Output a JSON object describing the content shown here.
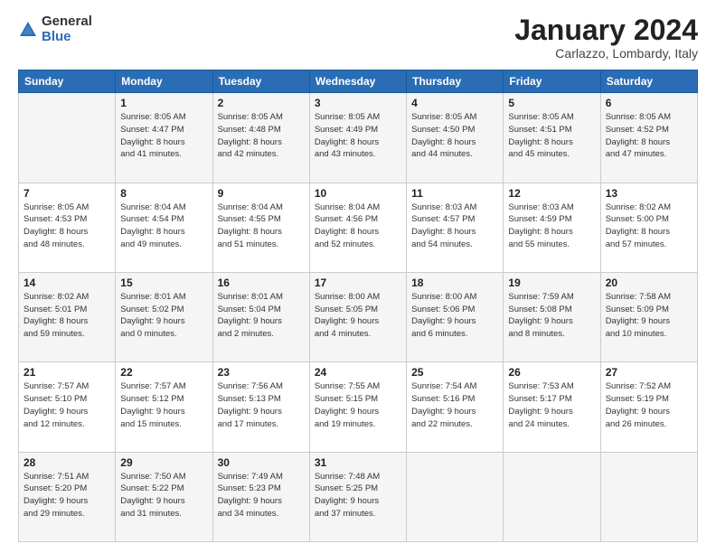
{
  "logo": {
    "general": "General",
    "blue": "Blue"
  },
  "header": {
    "month": "January 2024",
    "location": "Carlazzo, Lombardy, Italy"
  },
  "weekdays": [
    "Sunday",
    "Monday",
    "Tuesday",
    "Wednesday",
    "Thursday",
    "Friday",
    "Saturday"
  ],
  "weeks": [
    [
      {
        "day": "",
        "info": ""
      },
      {
        "day": "1",
        "info": "Sunrise: 8:05 AM\nSunset: 4:47 PM\nDaylight: 8 hours\nand 41 minutes."
      },
      {
        "day": "2",
        "info": "Sunrise: 8:05 AM\nSunset: 4:48 PM\nDaylight: 8 hours\nand 42 minutes."
      },
      {
        "day": "3",
        "info": "Sunrise: 8:05 AM\nSunset: 4:49 PM\nDaylight: 8 hours\nand 43 minutes."
      },
      {
        "day": "4",
        "info": "Sunrise: 8:05 AM\nSunset: 4:50 PM\nDaylight: 8 hours\nand 44 minutes."
      },
      {
        "day": "5",
        "info": "Sunrise: 8:05 AM\nSunset: 4:51 PM\nDaylight: 8 hours\nand 45 minutes."
      },
      {
        "day": "6",
        "info": "Sunrise: 8:05 AM\nSunset: 4:52 PM\nDaylight: 8 hours\nand 47 minutes."
      }
    ],
    [
      {
        "day": "7",
        "info": "Sunrise: 8:05 AM\nSunset: 4:53 PM\nDaylight: 8 hours\nand 48 minutes."
      },
      {
        "day": "8",
        "info": "Sunrise: 8:04 AM\nSunset: 4:54 PM\nDaylight: 8 hours\nand 49 minutes."
      },
      {
        "day": "9",
        "info": "Sunrise: 8:04 AM\nSunset: 4:55 PM\nDaylight: 8 hours\nand 51 minutes."
      },
      {
        "day": "10",
        "info": "Sunrise: 8:04 AM\nSunset: 4:56 PM\nDaylight: 8 hours\nand 52 minutes."
      },
      {
        "day": "11",
        "info": "Sunrise: 8:03 AM\nSunset: 4:57 PM\nDaylight: 8 hours\nand 54 minutes."
      },
      {
        "day": "12",
        "info": "Sunrise: 8:03 AM\nSunset: 4:59 PM\nDaylight: 8 hours\nand 55 minutes."
      },
      {
        "day": "13",
        "info": "Sunrise: 8:02 AM\nSunset: 5:00 PM\nDaylight: 8 hours\nand 57 minutes."
      }
    ],
    [
      {
        "day": "14",
        "info": "Sunrise: 8:02 AM\nSunset: 5:01 PM\nDaylight: 8 hours\nand 59 minutes."
      },
      {
        "day": "15",
        "info": "Sunrise: 8:01 AM\nSunset: 5:02 PM\nDaylight: 9 hours\nand 0 minutes."
      },
      {
        "day": "16",
        "info": "Sunrise: 8:01 AM\nSunset: 5:04 PM\nDaylight: 9 hours\nand 2 minutes."
      },
      {
        "day": "17",
        "info": "Sunrise: 8:00 AM\nSunset: 5:05 PM\nDaylight: 9 hours\nand 4 minutes."
      },
      {
        "day": "18",
        "info": "Sunrise: 8:00 AM\nSunset: 5:06 PM\nDaylight: 9 hours\nand 6 minutes."
      },
      {
        "day": "19",
        "info": "Sunrise: 7:59 AM\nSunset: 5:08 PM\nDaylight: 9 hours\nand 8 minutes."
      },
      {
        "day": "20",
        "info": "Sunrise: 7:58 AM\nSunset: 5:09 PM\nDaylight: 9 hours\nand 10 minutes."
      }
    ],
    [
      {
        "day": "21",
        "info": "Sunrise: 7:57 AM\nSunset: 5:10 PM\nDaylight: 9 hours\nand 12 minutes."
      },
      {
        "day": "22",
        "info": "Sunrise: 7:57 AM\nSunset: 5:12 PM\nDaylight: 9 hours\nand 15 minutes."
      },
      {
        "day": "23",
        "info": "Sunrise: 7:56 AM\nSunset: 5:13 PM\nDaylight: 9 hours\nand 17 minutes."
      },
      {
        "day": "24",
        "info": "Sunrise: 7:55 AM\nSunset: 5:15 PM\nDaylight: 9 hours\nand 19 minutes."
      },
      {
        "day": "25",
        "info": "Sunrise: 7:54 AM\nSunset: 5:16 PM\nDaylight: 9 hours\nand 22 minutes."
      },
      {
        "day": "26",
        "info": "Sunrise: 7:53 AM\nSunset: 5:17 PM\nDaylight: 9 hours\nand 24 minutes."
      },
      {
        "day": "27",
        "info": "Sunrise: 7:52 AM\nSunset: 5:19 PM\nDaylight: 9 hours\nand 26 minutes."
      }
    ],
    [
      {
        "day": "28",
        "info": "Sunrise: 7:51 AM\nSunset: 5:20 PM\nDaylight: 9 hours\nand 29 minutes."
      },
      {
        "day": "29",
        "info": "Sunrise: 7:50 AM\nSunset: 5:22 PM\nDaylight: 9 hours\nand 31 minutes."
      },
      {
        "day": "30",
        "info": "Sunrise: 7:49 AM\nSunset: 5:23 PM\nDaylight: 9 hours\nand 34 minutes."
      },
      {
        "day": "31",
        "info": "Sunrise: 7:48 AM\nSunset: 5:25 PM\nDaylight: 9 hours\nand 37 minutes."
      },
      {
        "day": "",
        "info": ""
      },
      {
        "day": "",
        "info": ""
      },
      {
        "day": "",
        "info": ""
      }
    ]
  ]
}
